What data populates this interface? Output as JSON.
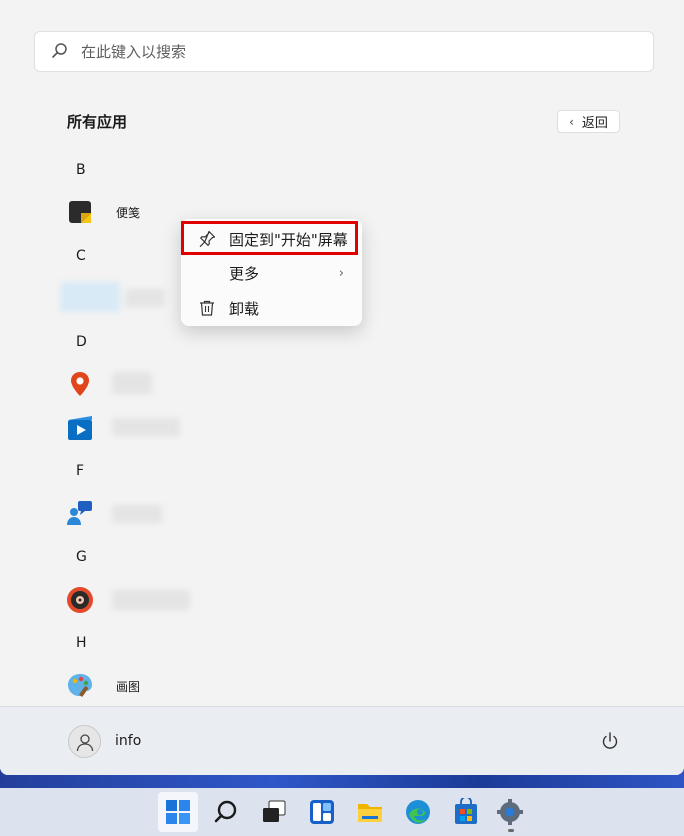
{
  "search": {
    "placeholder": "在此键入以搜索"
  },
  "header": {
    "title": "所有应用",
    "back_label": "返回"
  },
  "groups": {
    "b": {
      "letter": "B",
      "apps": [
        {
          "label": "便笺",
          "icon": "sticky-notes-icon"
        }
      ]
    },
    "c": {
      "letter": "C"
    },
    "d": {
      "letter": "D"
    },
    "f": {
      "letter": "F"
    },
    "g": {
      "letter": "G"
    },
    "h": {
      "letter": "H",
      "apps": [
        {
          "label": "画图",
          "icon": "paint-icon"
        }
      ]
    }
  },
  "context_menu": {
    "items": [
      {
        "label": "固定到\"开始\"屏幕",
        "icon": "pin-icon"
      },
      {
        "label": "更多",
        "icon": "chevron-right-icon"
      },
      {
        "label": "卸载",
        "icon": "trash-icon"
      }
    ]
  },
  "user": {
    "name": "info"
  },
  "taskbar": {
    "icons": [
      "windows-start-icon",
      "search-icon",
      "task-view-icon",
      "widgets-icon",
      "file-explorer-icon",
      "edge-icon",
      "store-icon",
      "settings-icon"
    ]
  },
  "colors": {
    "highlight": "#e00000",
    "accent": "#0067c0"
  }
}
